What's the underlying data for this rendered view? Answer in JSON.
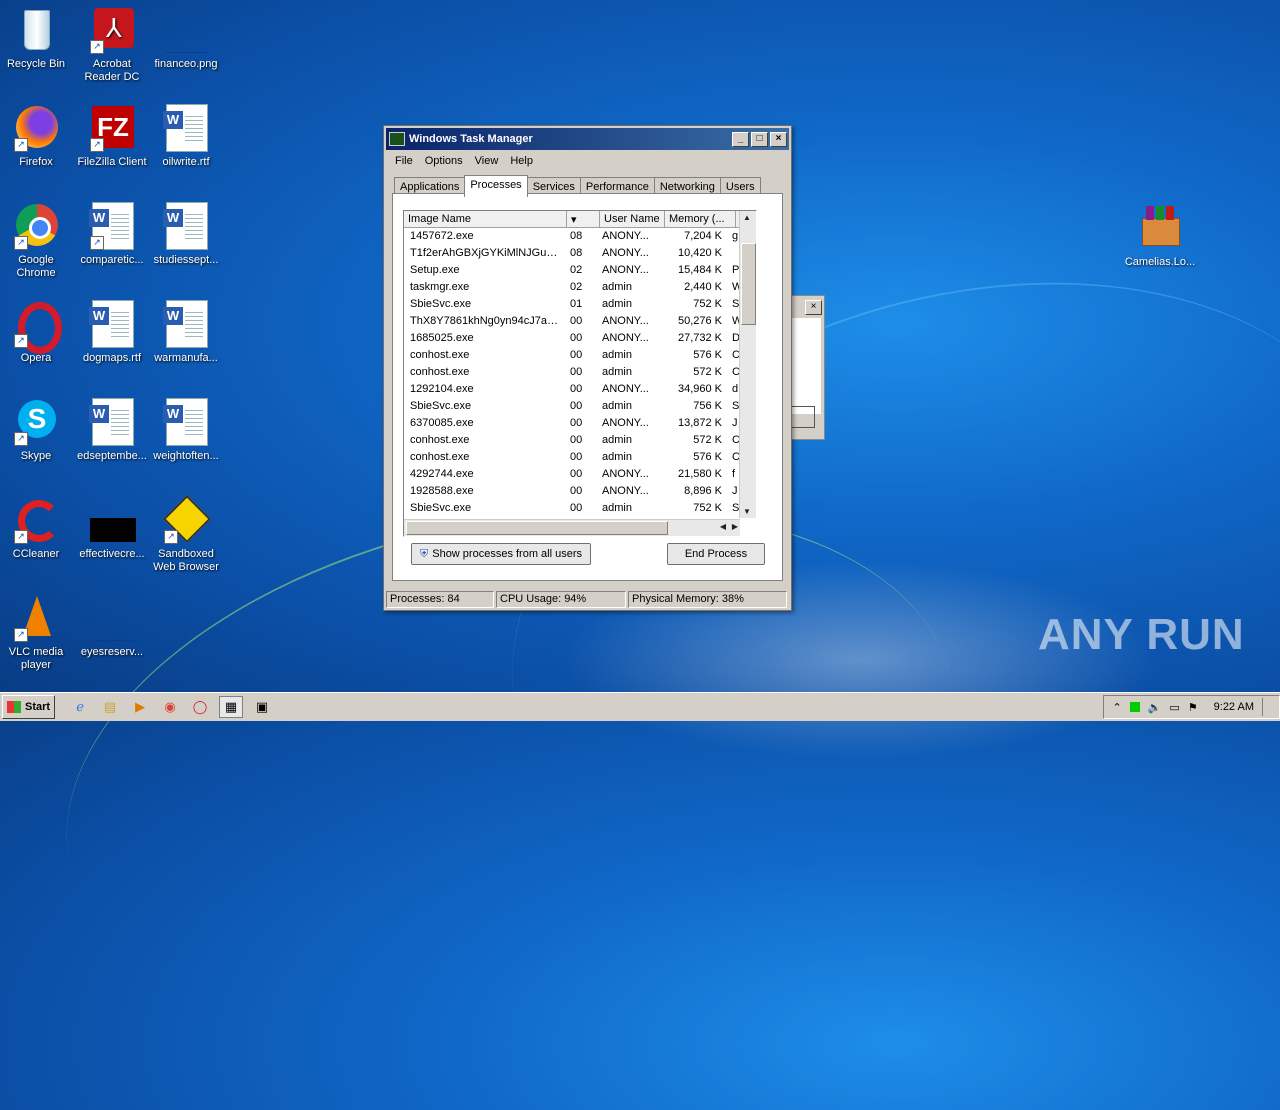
{
  "desktop": {
    "icons": [
      {
        "label": "Recycle Bin"
      },
      {
        "label": "Acrobat Reader DC"
      },
      {
        "label": "financeo.png"
      },
      {
        "label": "Firefox"
      },
      {
        "label": "FileZilla Client"
      },
      {
        "label": "oilwrite.rtf"
      },
      {
        "label": "Google Chrome"
      },
      {
        "label": "comparetic..."
      },
      {
        "label": "studiessept..."
      },
      {
        "label": "Opera"
      },
      {
        "label": "dogmaps.rtf"
      },
      {
        "label": "warmanufa..."
      },
      {
        "label": "Skype"
      },
      {
        "label": "edseptembe..."
      },
      {
        "label": "weightoften..."
      },
      {
        "label": "CCleaner"
      },
      {
        "label": "effectivecre..."
      },
      {
        "label": "Sandboxed Web Browser"
      },
      {
        "label": "VLC media player"
      },
      {
        "label": "eyesreserv..."
      },
      {
        "label": "Camelias.Lo..."
      }
    ]
  },
  "task_manager": {
    "title": "Windows Task Manager",
    "title_buttons": {
      "minimize": "_",
      "maximize": "□",
      "close": "×"
    },
    "menu": [
      "File",
      "Options",
      "View",
      "Help"
    ],
    "tabs": [
      "Applications",
      "Processes",
      "Services",
      "Performance",
      "Networking",
      "Users"
    ],
    "active_tab": "Processes",
    "columns": [
      "Image Name",
      "User Name",
      "Memory (...",
      "D"
    ],
    "processes": [
      {
        "name": "1457672.exe",
        "cpu": "08",
        "user": "ANONY...",
        "mem": "7,204 K",
        "desc": "g"
      },
      {
        "name": "T1f2erAhGBXjGYKiMlNJGukI....",
        "cpu": "08",
        "user": "ANONY...",
        "mem": "10,420 K",
        "desc": ""
      },
      {
        "name": "Setup.exe",
        "cpu": "02",
        "user": "ANONY...",
        "mem": "15,484 K",
        "desc": "P"
      },
      {
        "name": "taskmgr.exe",
        "cpu": "02",
        "user": "admin",
        "mem": "2,440 K",
        "desc": "W"
      },
      {
        "name": "SbieSvc.exe",
        "cpu": "01",
        "user": "admin",
        "mem": "752 K",
        "desc": "S"
      },
      {
        "name": "ThX8Y7861khNg0yn94cJ7ao...",
        "cpu": "00",
        "user": "ANONY...",
        "mem": "50,276 K",
        "desc": "W"
      },
      {
        "name": "1685025.exe",
        "cpu": "00",
        "user": "ANONY...",
        "mem": "27,732 K",
        "desc": "D"
      },
      {
        "name": "conhost.exe",
        "cpu": "00",
        "user": "admin",
        "mem": "576 K",
        "desc": "C"
      },
      {
        "name": "conhost.exe",
        "cpu": "00",
        "user": "admin",
        "mem": "572 K",
        "desc": "C"
      },
      {
        "name": "1292104.exe",
        "cpu": "00",
        "user": "ANONY...",
        "mem": "34,960 K",
        "desc": "d"
      },
      {
        "name": "SbieSvc.exe",
        "cpu": "00",
        "user": "admin",
        "mem": "756 K",
        "desc": "S"
      },
      {
        "name": "6370085.exe",
        "cpu": "00",
        "user": "ANONY...",
        "mem": "13,872 K",
        "desc": "J"
      },
      {
        "name": "conhost.exe",
        "cpu": "00",
        "user": "admin",
        "mem": "572 K",
        "desc": "C"
      },
      {
        "name": "conhost.exe",
        "cpu": "00",
        "user": "admin",
        "mem": "576 K",
        "desc": "C"
      },
      {
        "name": "4292744.exe",
        "cpu": "00",
        "user": "ANONY...",
        "mem": "21,580 K",
        "desc": "f"
      },
      {
        "name": "1928588.exe",
        "cpu": "00",
        "user": "ANONY...",
        "mem": "8,896 K",
        "desc": "J"
      },
      {
        "name": "SbieSvc.exe",
        "cpu": "00",
        "user": "admin",
        "mem": "752 K",
        "desc": "S"
      }
    ],
    "show_all_button": "Show processes from all users",
    "end_process_button": "End Process",
    "status": {
      "processes": "Processes: 84",
      "cpu": "CPU Usage: 94%",
      "memory": "Physical Memory: 38%"
    }
  },
  "taskbar": {
    "start_label": "Start",
    "clock": "9:22 AM"
  },
  "watermark": "ANY RUN"
}
